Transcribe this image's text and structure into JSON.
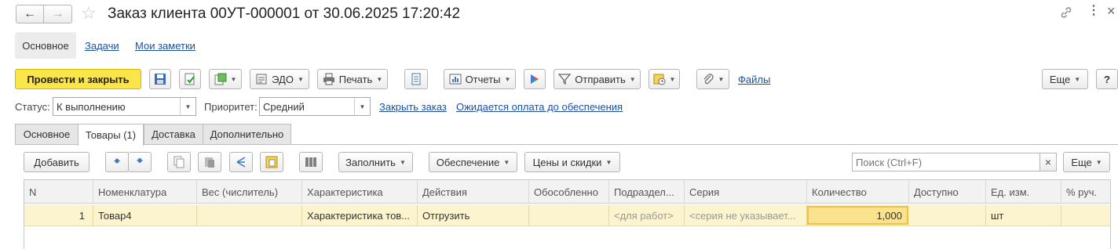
{
  "window": {
    "title": "Заказ клиента 00УТ-000001 от 30.06.2025 17:20:42"
  },
  "subnav": [
    "Основное",
    "Задачи",
    "Мои заметки"
  ],
  "toolbar": {
    "post_close": "Провести и закрыть",
    "edo": "ЭДО",
    "print": "Печать",
    "reports": "Отчеты",
    "send": "Отправить",
    "files": "Файлы",
    "more": "Еще",
    "help": "?"
  },
  "status": {
    "status_label": "Статус:",
    "status_value": "К выполнению",
    "priority_label": "Приоритет:",
    "priority_value": "Средний",
    "close_order": "Закрыть заказ",
    "awaiting": "Ожидается оплата до обеспечения"
  },
  "tabs": [
    "Основное",
    "Товары (1)",
    "Доставка",
    "Дополнительно"
  ],
  "table_toolbar": {
    "add": "Добавить",
    "fill": "Заполнить",
    "provision": "Обеспечение",
    "prices": "Цены и скидки",
    "search_placeholder": "Поиск (Ctrl+F)",
    "more": "Еще"
  },
  "table": {
    "columns": [
      "N",
      "Номенклатура",
      "Вес (числитель)",
      "Характеристика",
      "Действия",
      "Обособленно",
      "Подраздел...",
      "Серия",
      "Количество",
      "Доступно",
      "Ед. изм.",
      "% руч."
    ],
    "rows": [
      {
        "n": "1",
        "item": "Товар4",
        "weight": "",
        "characteristic": "Характеристика тов...",
        "action": "Отгрузить",
        "separate": "",
        "division": "<для работ>",
        "series": "<серия не указывает...",
        "quantity": "1,000",
        "available": "",
        "unit": "шт",
        "manual_pct": ""
      }
    ]
  },
  "colors": {
    "accent_yellow": "#fbe54a",
    "selected_row": "#fbf4cf",
    "link": "#1a4fa3"
  }
}
